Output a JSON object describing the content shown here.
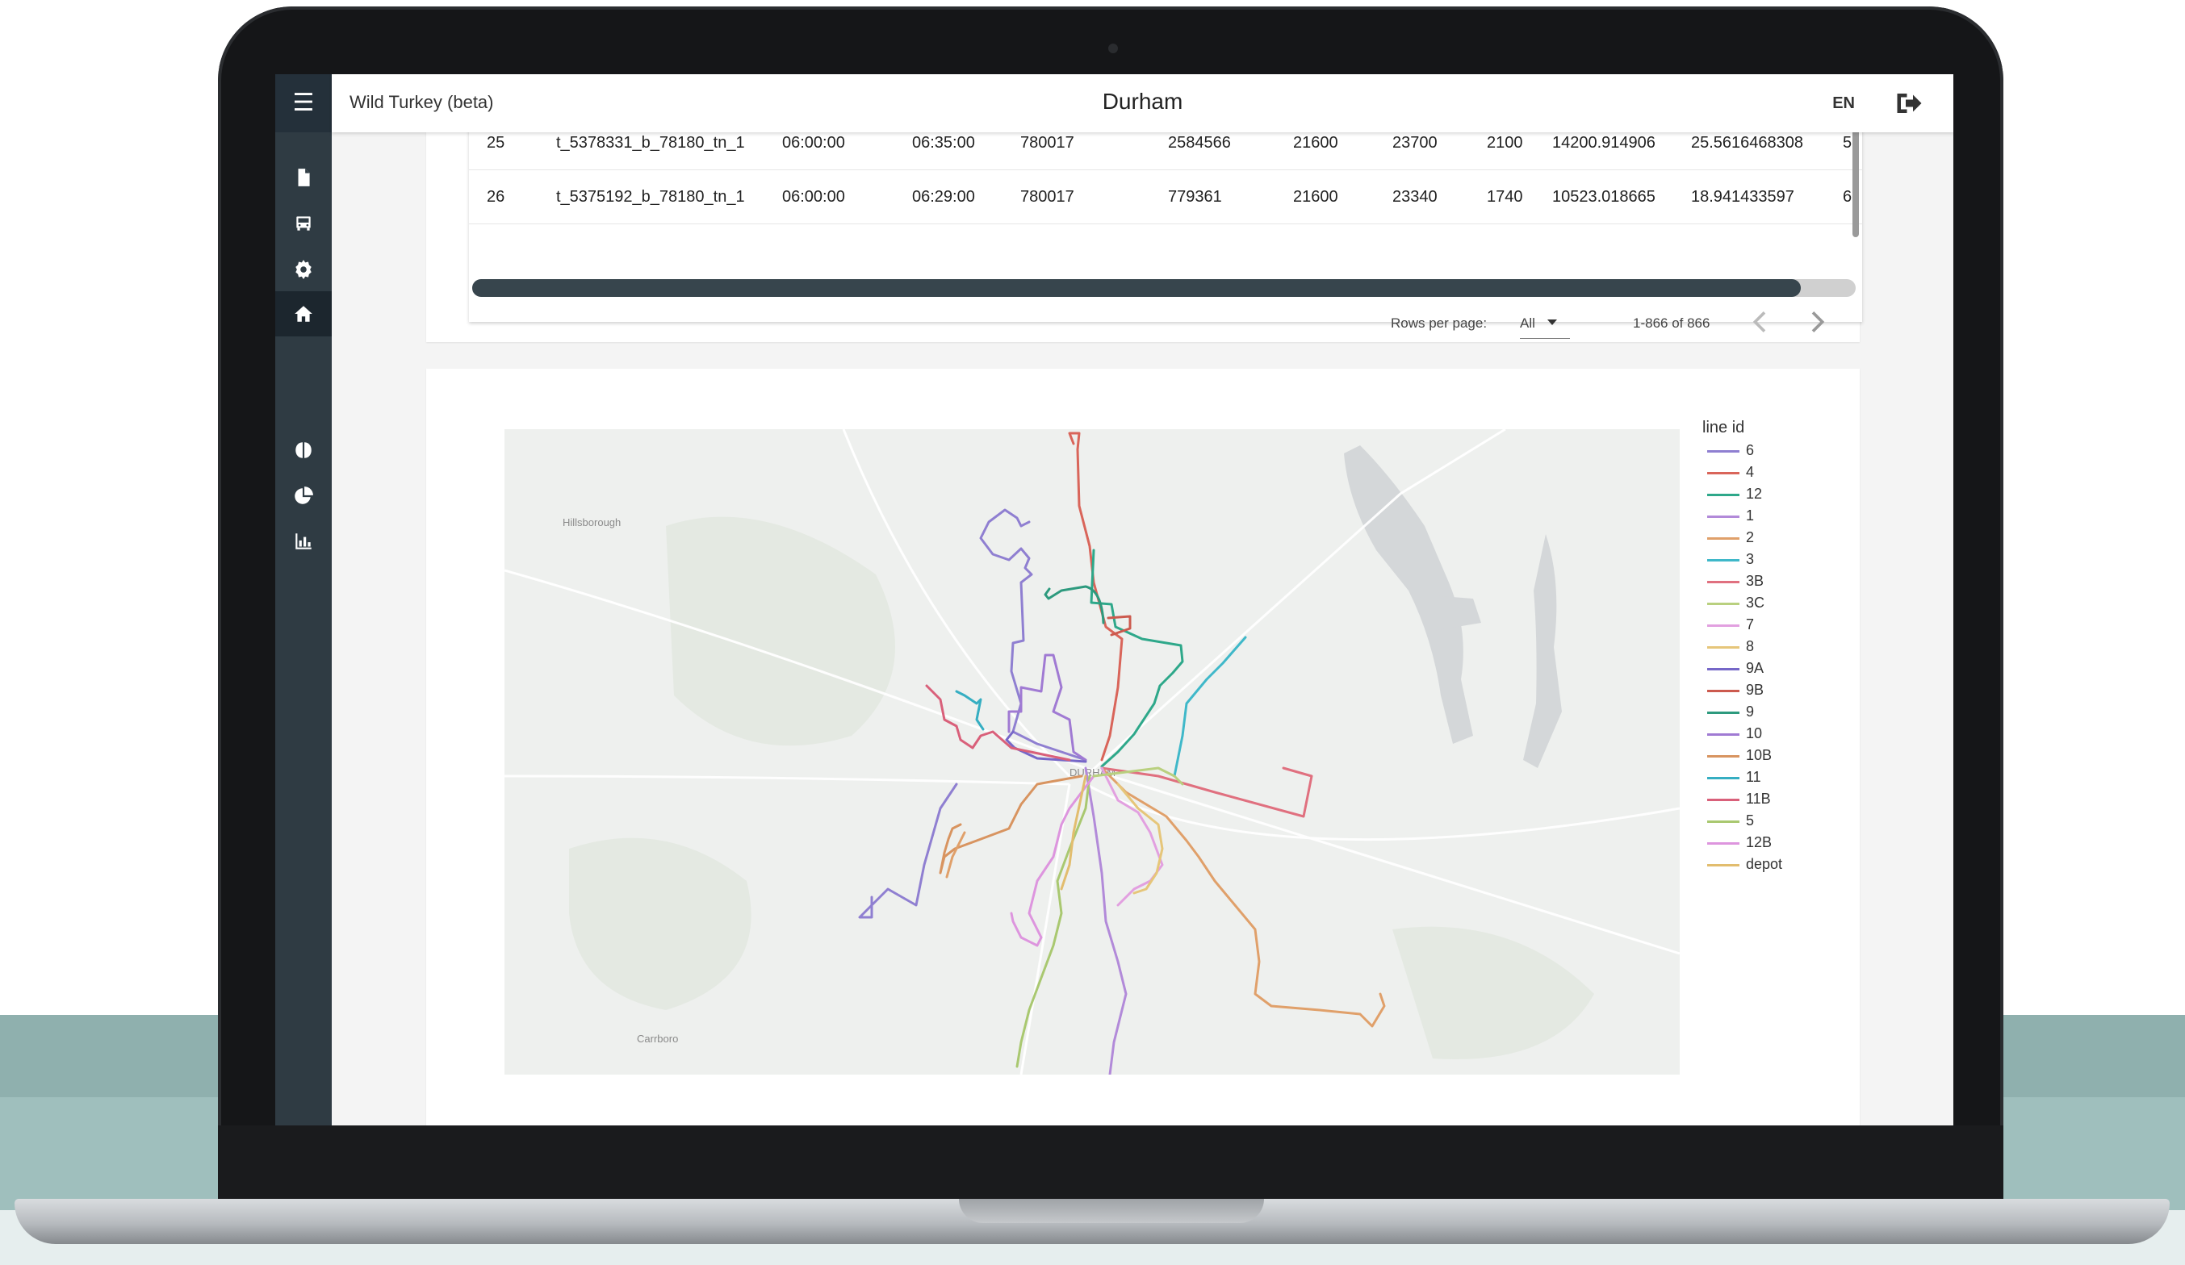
{
  "app": {
    "title": "Wild Turkey (beta)",
    "city": "Durham",
    "language": "EN"
  },
  "sidebar": {
    "items": [
      {
        "name": "document-icon"
      },
      {
        "name": "bus-icon"
      },
      {
        "name": "gear-icon"
      },
      {
        "name": "home-icon",
        "active": true
      },
      {
        "name": "brain-icon"
      },
      {
        "name": "pie-chart-icon"
      },
      {
        "name": "bar-chart-icon"
      }
    ]
  },
  "table": {
    "rows": [
      [
        "25",
        "t_5378331_b_78180_tn_1",
        "06:00:00",
        "06:35:00",
        "780017",
        "2584566",
        "21600",
        "23700",
        "2100",
        "14200.914906",
        "25.5616468308",
        "5"
      ],
      [
        "26",
        "t_5375192_b_78180_tn_1",
        "06:00:00",
        "06:29:00",
        "780017",
        "779361",
        "21600",
        "23340",
        "1740",
        "10523.018665",
        "18.941433597",
        "6"
      ]
    ],
    "pagination": {
      "rows_per_page_label": "Rows per page:",
      "rows_per_page_value": "All",
      "range": "1-866 of 866"
    }
  },
  "map": {
    "place_labels": [
      "Hillsborough",
      "Carrboro",
      "DURHAM"
    ],
    "legend": {
      "title": "line id",
      "items": [
        {
          "label": "6",
          "color": "#8f7fd1"
        },
        {
          "label": "4",
          "color": "#d9655a"
        },
        {
          "label": "12",
          "color": "#2ea88a"
        },
        {
          "label": "1",
          "color": "#b28ad9"
        },
        {
          "label": "2",
          "color": "#e0a06a"
        },
        {
          "label": "3",
          "color": "#3fb8c9"
        },
        {
          "label": "3B",
          "color": "#e0707f"
        },
        {
          "label": "3C",
          "color": "#b9d07f"
        },
        {
          "label": "7",
          "color": "#e2a0e0"
        },
        {
          "label": "8",
          "color": "#e6c67a"
        },
        {
          "label": "9A",
          "color": "#7667c8"
        },
        {
          "label": "9B",
          "color": "#cc5a4e"
        },
        {
          "label": "9",
          "color": "#2d9a7e"
        },
        {
          "label": "10",
          "color": "#a07ad3"
        },
        {
          "label": "10B",
          "color": "#d89460"
        },
        {
          "label": "11",
          "color": "#35aec2"
        },
        {
          "label": "11B",
          "color": "#d9607a"
        },
        {
          "label": "5",
          "color": "#a9c870"
        },
        {
          "label": "12B",
          "color": "#dd95de"
        },
        {
          "label": "depot",
          "color": "#e2bd6e"
        }
      ]
    }
  }
}
